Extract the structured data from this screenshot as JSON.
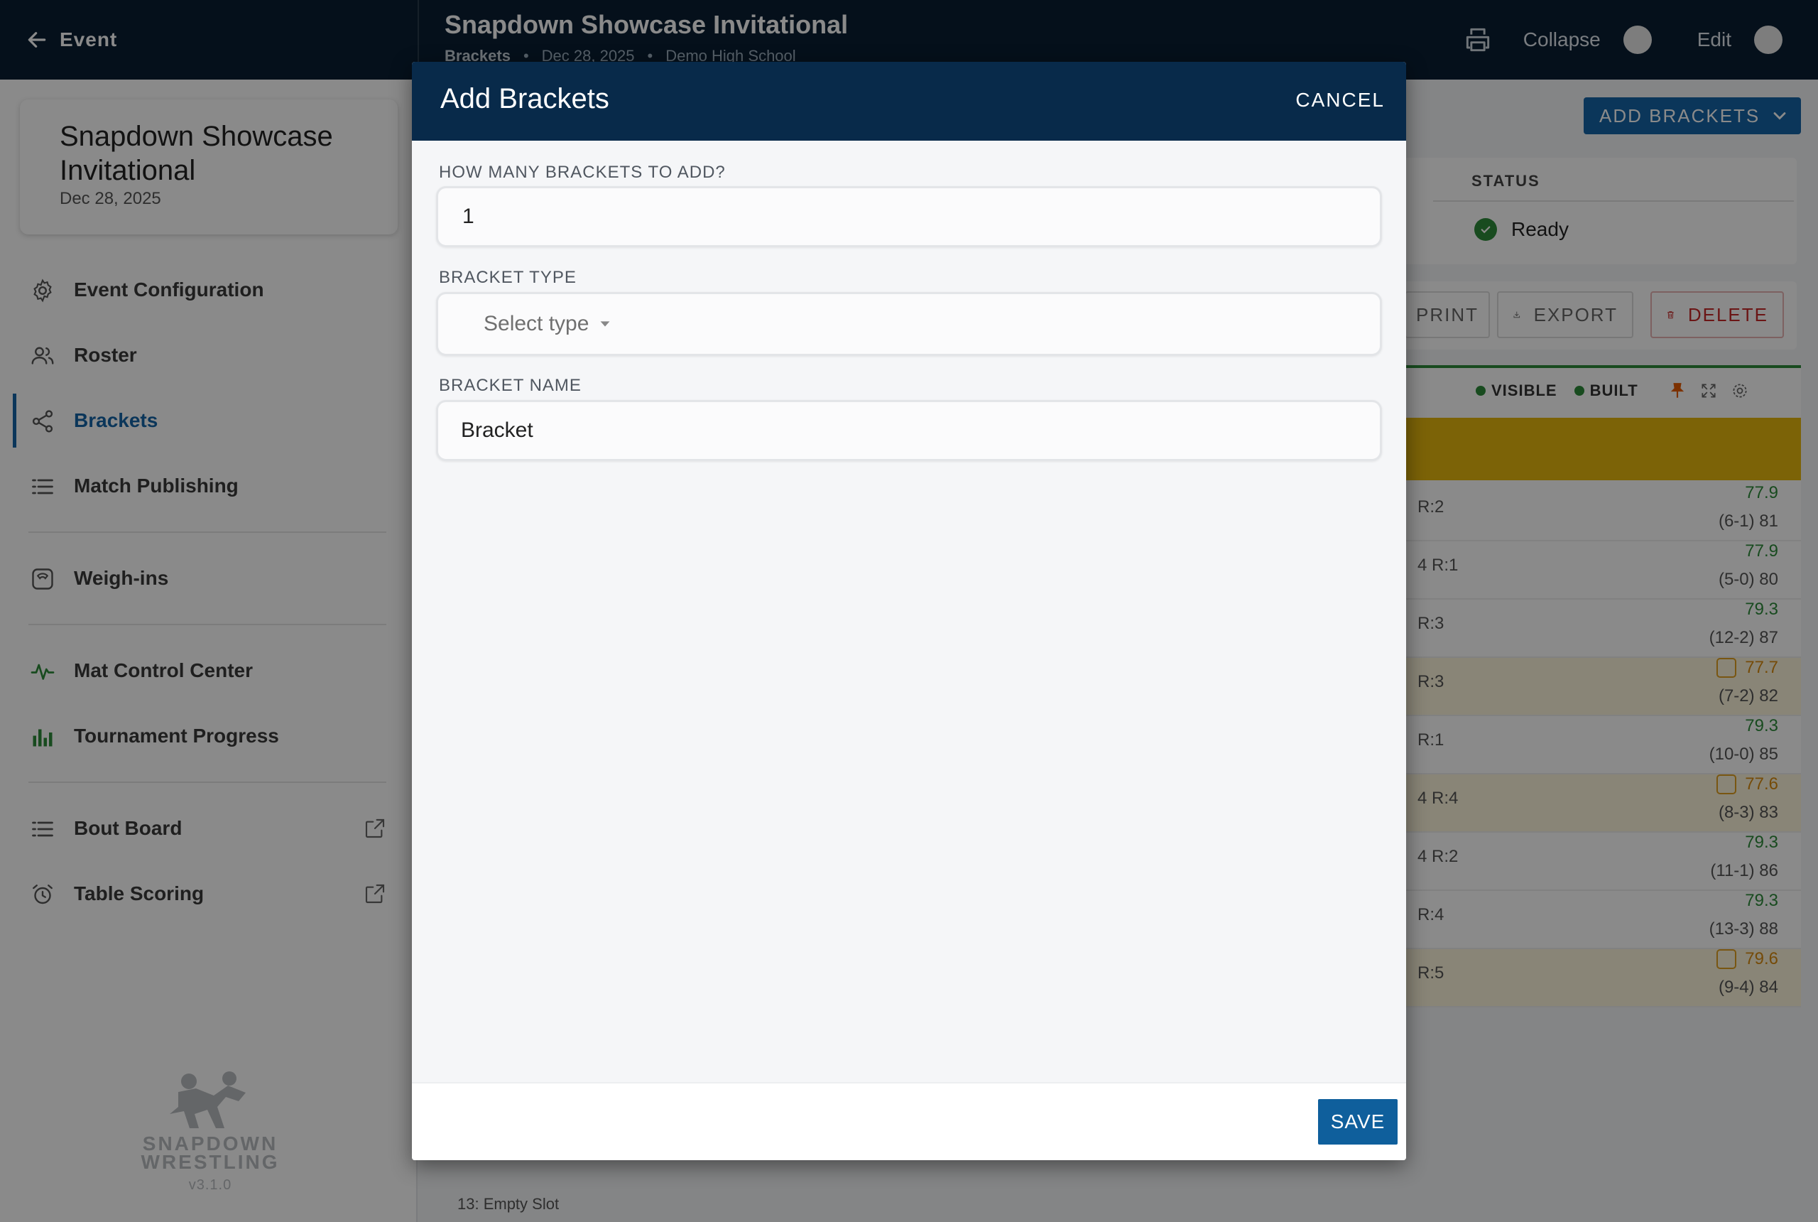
{
  "topbar": {
    "back_label": "Event",
    "title": "Snapdown Showcase Invitational",
    "breadcrumb": [
      "Brackets",
      "Dec 28, 2025",
      "Demo High School"
    ],
    "collapse_label": "Collapse",
    "edit_label": "Edit"
  },
  "sidebar": {
    "event_name": "Snapdown Showcase Invitational",
    "event_date": "Dec 28, 2025",
    "items": [
      {
        "label": "Event Configuration",
        "icon": "gear-icon"
      },
      {
        "label": "Roster",
        "icon": "users-icon"
      },
      {
        "label": "Brackets",
        "icon": "share-icon",
        "active": true
      },
      {
        "label": "Match Publishing",
        "icon": "list-icon"
      },
      {
        "label": "Weigh-ins",
        "icon": "scale-icon"
      },
      {
        "label": "Mat Control Center",
        "icon": "pulse-icon"
      },
      {
        "label": "Tournament Progress",
        "icon": "bar-chart-icon"
      },
      {
        "label": "Bout Board",
        "icon": "list-icon"
      },
      {
        "label": "Table Scoring",
        "icon": "alarm-clock-icon"
      }
    ],
    "logo_line1": "SNAPDOWN",
    "logo_line2": "WRESTLING",
    "version": "v3.1.0"
  },
  "main": {
    "add_brackets_label": "ADD BRACKETS",
    "status_header": "STATUS",
    "status_value": "Ready",
    "print_label": "PRINT",
    "export_label": "EXPORT",
    "delete_label": "DELETE",
    "legend_visible": "VISIBLE",
    "legend_built": "BUILT",
    "rows": [
      {
        "seed": "R:2",
        "weight": "77.9",
        "record": "(6-1) 81",
        "yellow": false
      },
      {
        "seed": "4  R:1",
        "weight": "77.9",
        "record": "(5-0) 80",
        "yellow": false
      },
      {
        "seed": "R:3",
        "weight": "79.3",
        "record": "(12-2) 87",
        "yellow": false
      },
      {
        "seed": "R:3",
        "weight": "77.7",
        "record": "(7-2) 82",
        "yellow": true
      },
      {
        "seed": "R:1",
        "weight": "79.3",
        "record": "(10-0) 85",
        "yellow": false
      },
      {
        "seed": "4  R:4",
        "weight": "77.6",
        "record": "(8-3) 83",
        "yellow": true
      },
      {
        "seed": "4  R:2",
        "weight": "79.3",
        "record": "(11-1) 86",
        "yellow": false
      },
      {
        "seed": "R:4",
        "weight": "79.3",
        "record": "(13-3) 88",
        "yellow": false
      },
      {
        "seed": "R:5",
        "weight": "79.6",
        "record": "(9-4) 84",
        "yellow": true
      }
    ],
    "empty_slot": "13: Empty Slot"
  },
  "modal": {
    "title": "Add Brackets",
    "cancel_label": "CANCEL",
    "qty_label": "HOW MANY BRACKETS TO ADD?",
    "qty_value": "1",
    "type_label": "BRACKET TYPE",
    "type_placeholder": "Select type",
    "name_label": "BRACKET NAME",
    "name_value": "Bracket",
    "save_label": "SAVE"
  },
  "colors": {
    "topbar": "#0a1f33",
    "modal_header": "#082a4a",
    "accent": "#1565a6",
    "success": "#2e8b3a",
    "warning": "#e6b80e"
  }
}
